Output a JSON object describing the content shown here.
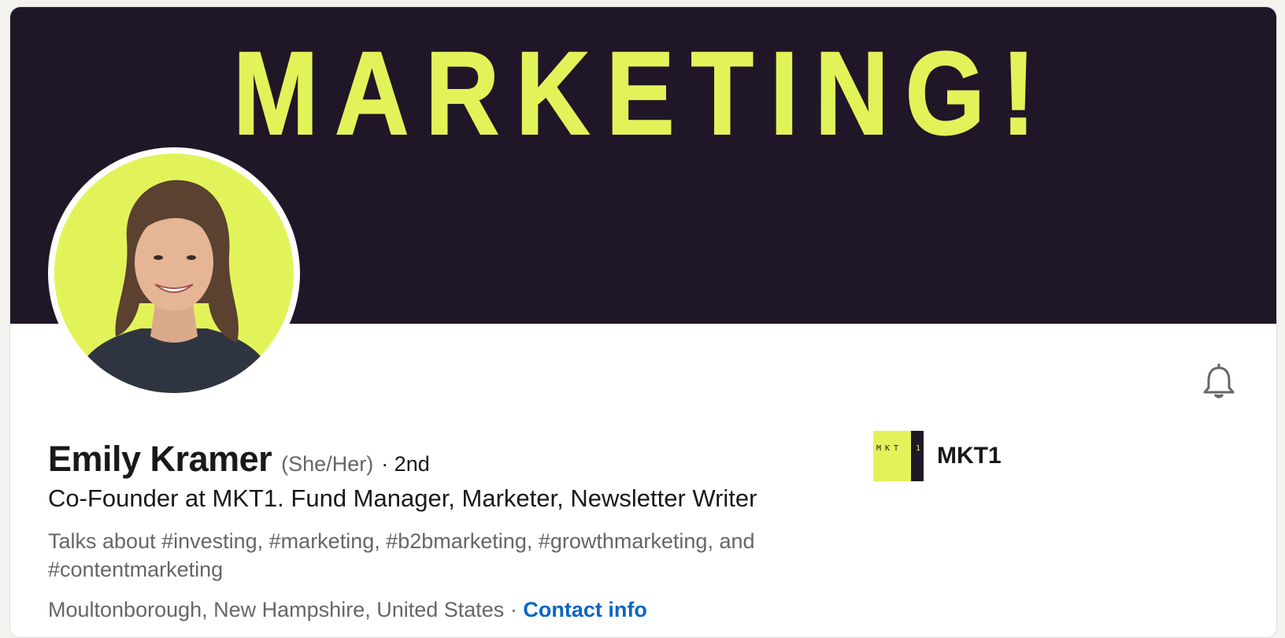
{
  "banner": {
    "text": "MARKETING!",
    "background_color": "#1f1727",
    "accent_color": "#e2f35a"
  },
  "profile": {
    "name": "Emily Kramer",
    "pronouns": "(She/Her)",
    "degree": "· 2nd",
    "headline": "Co-Founder at MKT1. Fund Manager, Marketer, Newsletter Writer",
    "talks_about": "Talks about #investing, #marketing, #b2bmarketing, #growthmarketing, and #contentmarketing",
    "location": "Moultonborough, New Hampshire, United States",
    "separator": "·",
    "contact_label": "Contact info"
  },
  "company": {
    "name": "MKT1",
    "logo_letters": "MKT",
    "logo_digit": "1"
  },
  "icons": {
    "bell": "bell-icon"
  },
  "colors": {
    "link": "#0a66c2",
    "text_primary": "#191919",
    "text_secondary": "#666666"
  }
}
